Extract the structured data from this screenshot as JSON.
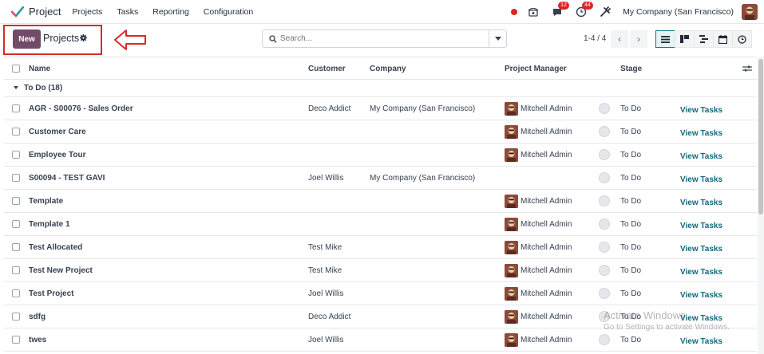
{
  "navbar": {
    "app_title": "Project",
    "menu": [
      "Projects",
      "Tasks",
      "Reporting",
      "Configuration"
    ],
    "messages_badge": "12",
    "activity_badge": "44",
    "company": "My Company (San Francisco)"
  },
  "control": {
    "new_label": "New",
    "breadcrumb": "Projects",
    "search_placeholder": "Search...",
    "pager": "1-4 / 4"
  },
  "table": {
    "headers": {
      "name": "Name",
      "customer": "Customer",
      "company": "Company",
      "manager": "Project Manager",
      "stage": "Stage"
    },
    "group_label": "To Do (18)",
    "rows": [
      {
        "name": "AGR - S00076 - Sales Order",
        "customer": "Deco Addict",
        "company": "My Company (San Francisco)",
        "manager": "Mitchell Admin",
        "stage": "To Do",
        "action": "View Tasks"
      },
      {
        "name": "Customer Care",
        "customer": "",
        "company": "",
        "manager": "Mitchell Admin",
        "stage": "To Do",
        "action": "View Tasks"
      },
      {
        "name": "Employee Tour",
        "customer": "",
        "company": "",
        "manager": "Mitchell Admin",
        "stage": "To Do",
        "action": "View Tasks"
      },
      {
        "name": "S00094 - TEST GAVI",
        "customer": "Joel Willis",
        "company": "My Company (San Francisco)",
        "manager": "",
        "stage": "To Do",
        "action": "View Tasks"
      },
      {
        "name": "Template",
        "customer": "",
        "company": "",
        "manager": "Mitchell Admin",
        "stage": "To Do",
        "action": "View Tasks"
      },
      {
        "name": "Template 1",
        "customer": "",
        "company": "",
        "manager": "Mitchell Admin",
        "stage": "To Do",
        "action": "View Tasks"
      },
      {
        "name": "Test Allocated",
        "customer": "Test Mike",
        "company": "",
        "manager": "Mitchell Admin",
        "stage": "To Do",
        "action": "View Tasks"
      },
      {
        "name": "Test New Project",
        "customer": "Test Mike",
        "company": "",
        "manager": "Mitchell Admin",
        "stage": "To Do",
        "action": "View Tasks"
      },
      {
        "name": "Test Project",
        "customer": "Joel Willis",
        "company": "",
        "manager": "Mitchell Admin",
        "stage": "To Do",
        "action": "View Tasks"
      },
      {
        "name": "sdfg",
        "customer": "Deco Addict",
        "company": "",
        "manager": "Mitchell Admin",
        "stage": "To Do",
        "action": "View Tasks"
      },
      {
        "name": "twes",
        "customer": "Joel Willis",
        "company": "",
        "manager": "Mitchell Admin",
        "stage": "To Do",
        "action": "View Tasks"
      }
    ]
  },
  "watermark": {
    "line1": "Activate Windows",
    "line2": "Go to Settings to activate Windows."
  },
  "colors": {
    "brand": "#714b67",
    "link": "#0f6a80",
    "highlight": "#d62b2b",
    "badge": "#dc2626"
  }
}
